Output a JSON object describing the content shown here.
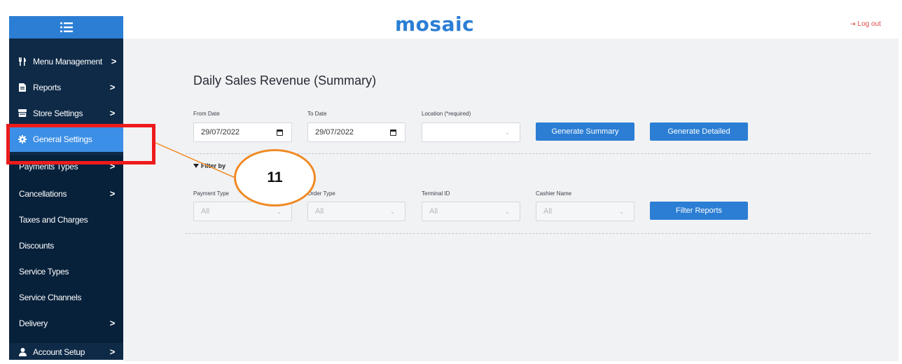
{
  "brand": {
    "name": "mosaic",
    "color": "#2b7ed4"
  },
  "header": {
    "logout_label": "Log out",
    "logout_icon": "logout-icon"
  },
  "sidebar": {
    "toggle_icon": "list-menu-icon",
    "items": [
      {
        "label": "Menu Management",
        "icon": "utensils-icon",
        "chevron": ">"
      },
      {
        "label": "Reports",
        "icon": "document-icon",
        "chevron": ">"
      },
      {
        "label": "Store Settings",
        "icon": "store-icon",
        "chevron": ">"
      },
      {
        "label": "General Settings",
        "icon": "gear-icon",
        "active": true
      }
    ],
    "sub_items": [
      {
        "label": "Payments Types",
        "chevron": ">"
      },
      {
        "label": "Cancellations",
        "chevron": ">"
      },
      {
        "label": "Taxes and Charges"
      },
      {
        "label": "Discounts"
      },
      {
        "label": "Service Types"
      },
      {
        "label": "Service Channels"
      },
      {
        "label": "Delivery",
        "chevron": ">"
      }
    ],
    "bottom_item": {
      "label": "Account Setup",
      "icon": "user-icon",
      "chevron": ">"
    }
  },
  "page": {
    "title": "Daily Sales Revenue (Summary)",
    "from_date": {
      "label": "From Date",
      "value": "29/07/2022"
    },
    "to_date": {
      "label": "To Date",
      "value": "29/07/2022"
    },
    "location": {
      "label": "Location (*required)",
      "value": ""
    },
    "generate_summary_label": "Generate Summary",
    "generate_detailed_label": "Generate Detailed",
    "filter_by_label": "Filter by",
    "filters": {
      "payment_type": {
        "label": "Payment Type",
        "value": "All"
      },
      "order_type": {
        "label": "Order Type",
        "value": "All"
      },
      "terminal_id": {
        "label": "Terminal ID",
        "value": "All"
      },
      "cashier_name": {
        "label": "Cashier Name",
        "value": "All"
      }
    },
    "filter_reports_label": "Filter Reports"
  },
  "annotation": {
    "step_number": "11",
    "box_color": "#ee1b1b",
    "callout_color": "#f08a24"
  },
  "colors": {
    "sidebar": "#0e2a47",
    "accent": "#2b7ed4",
    "active_item": "#3c8fe6",
    "logout": "#e04b4b"
  }
}
